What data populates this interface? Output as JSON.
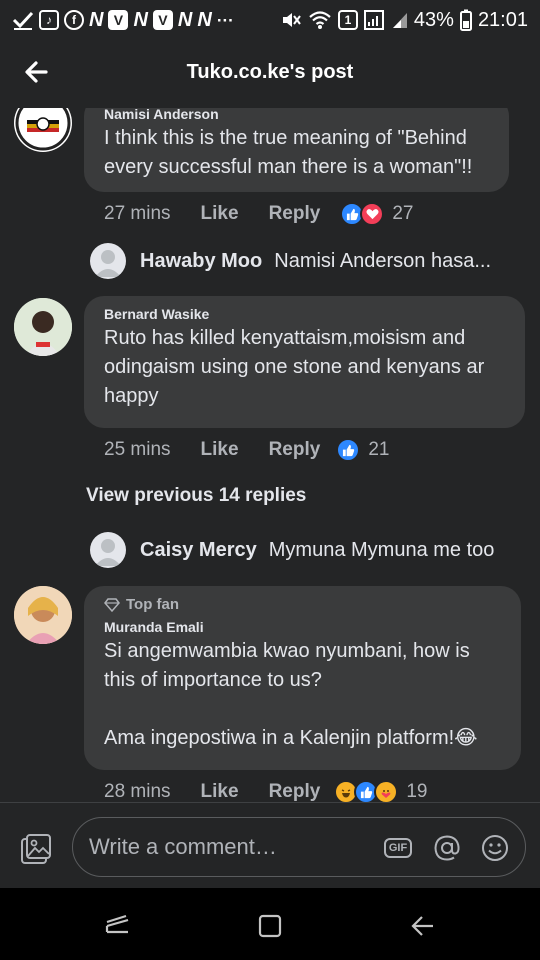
{
  "status_bar": {
    "battery": "43%",
    "time": "21:01",
    "sim_badge": "1",
    "notification_dots": "···"
  },
  "header": {
    "title": "Tuko.co.ke's post"
  },
  "comments": [
    {
      "name": "Namisi Anderson",
      "text": "I think this is the true meaning of \"Behind every successful man there is a woman\"!!",
      "time": "27 mins",
      "like": "Like",
      "reply": "Reply",
      "reactions": [
        "like",
        "love"
      ],
      "reaction_count": "27"
    },
    {
      "name": "Bernard Wasike",
      "text": "Ruto has killed kenyattaism,moisism and odingaism using one stone and kenyans ar happy",
      "time": "25 mins",
      "like": "Like",
      "reply": "Reply",
      "reactions": [
        "like"
      ],
      "reaction_count": "21"
    },
    {
      "badge": "Top fan",
      "name": "Muranda Emali",
      "text": "Si angemwambia kwao nyumbani, how is this of importance to us?\n\nAma ingepostiwa in a Kalenjin platform!😂",
      "time": "28 mins",
      "like": "Like",
      "reply": "Reply",
      "reactions": [
        "haha",
        "like",
        "care"
      ],
      "reaction_count": "19"
    }
  ],
  "replies": [
    {
      "name": "Hawaby Moo",
      "text": "Namisi Anderson hasa..."
    },
    {
      "name": "Caisy Mercy",
      "text": "Mymuna Mymuna me too"
    }
  ],
  "view_previous": "View previous 14 replies",
  "composer": {
    "placeholder": "Write a comment…",
    "gif_label": "GIF"
  },
  "colors": {
    "background": "#242526",
    "bubble": "#3a3b3c",
    "like_blue": "#2d88ff",
    "love_red": "#f33e58"
  }
}
